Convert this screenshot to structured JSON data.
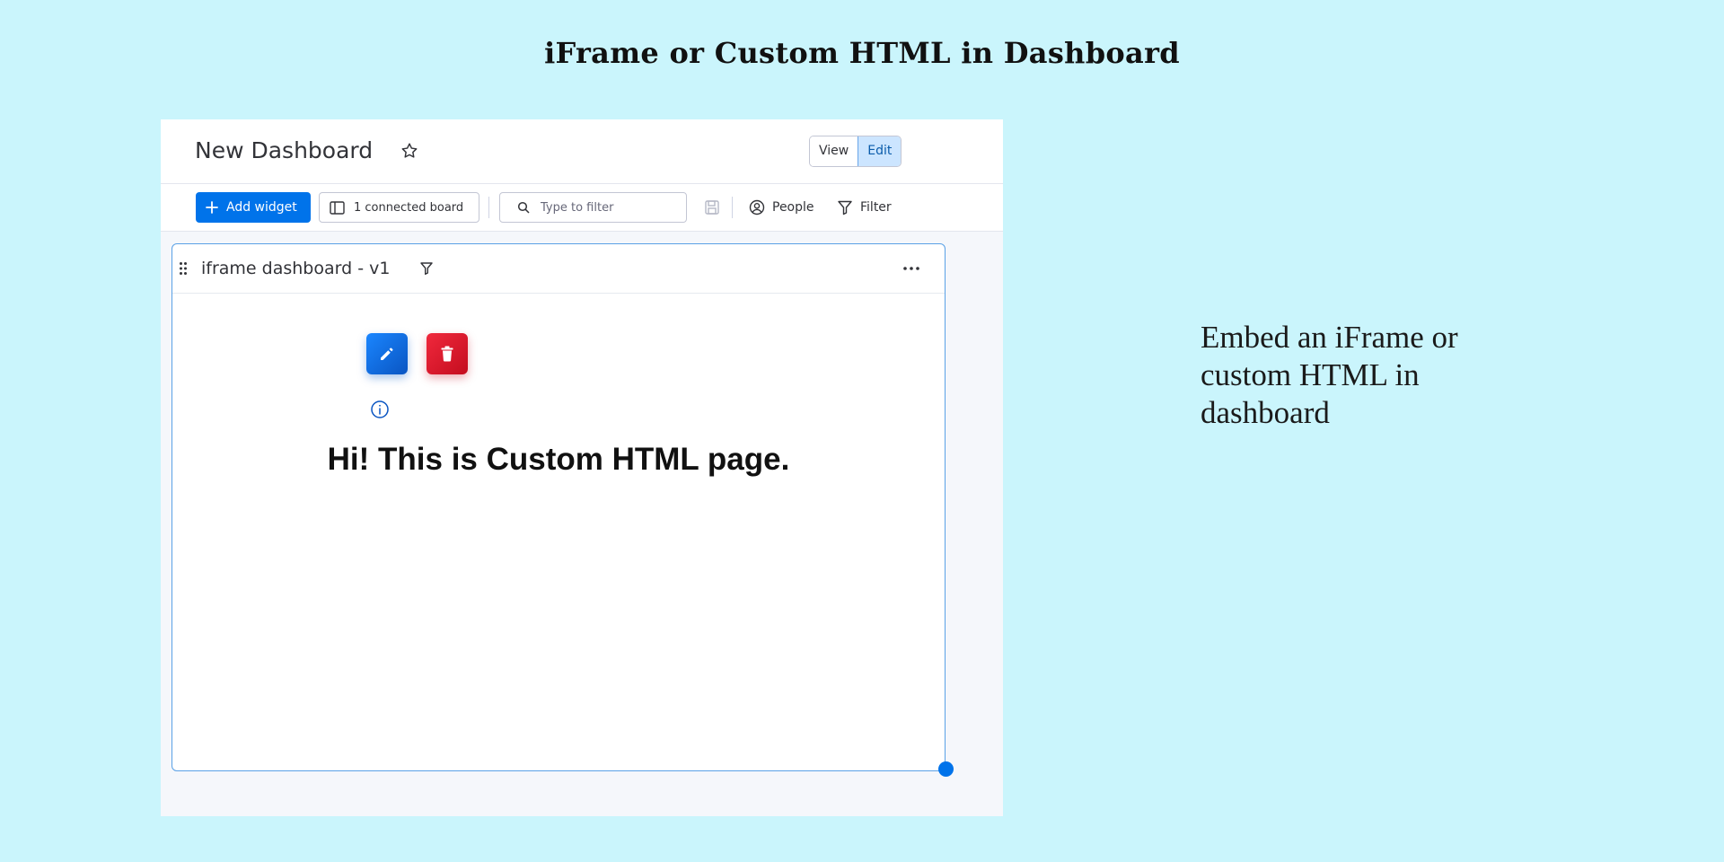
{
  "page": {
    "heading": "iFrame or Custom HTML in Dashboard",
    "caption": "Embed an iFrame or custom HTML in dashboard"
  },
  "dashboard": {
    "title": "New Dashboard",
    "mode_toggle": {
      "view_label": "View",
      "edit_label": "Edit",
      "active": "Edit"
    },
    "toolbar": {
      "add_widget_label": "Add widget",
      "connected_boards_label": "1 connected board",
      "search_placeholder": "Type to filter",
      "people_label": "People",
      "filter_label": "Filter"
    },
    "widget": {
      "title": "iframe dashboard - v1",
      "content_heading": "Hi! This is Custom HTML page."
    }
  },
  "icons": {
    "star": "star-icon",
    "plus": "plus-icon",
    "board": "board-icon",
    "search": "search-icon",
    "save": "save-icon",
    "people": "person-circle-icon",
    "filter": "filter-icon",
    "drag": "drag-handle-icon",
    "more": "more-icon",
    "edit": "pencil-icon",
    "delete": "trash-icon",
    "info": "info-icon"
  },
  "colors": {
    "background": "#caf5fc",
    "primary": "#0073ea",
    "delete": "#e2192c",
    "active_toggle": "#cce5ff"
  }
}
